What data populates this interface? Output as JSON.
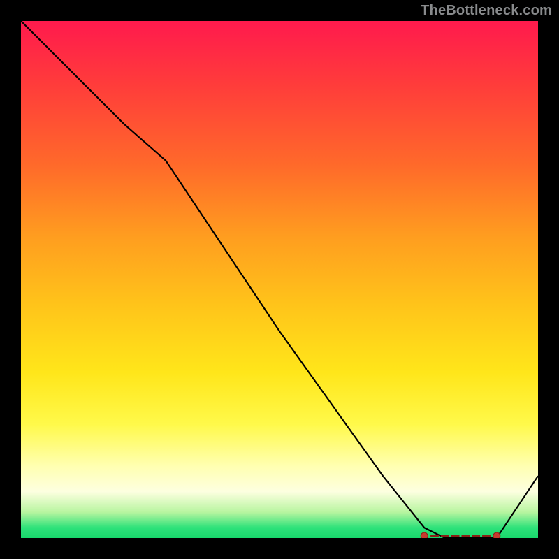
{
  "attribution": "TheBottleneck.com",
  "chart_data": {
    "type": "line",
    "title": "",
    "xlabel": "",
    "ylabel": "",
    "xlim": [
      0,
      100
    ],
    "ylim": [
      0,
      100
    ],
    "x": [
      0,
      10,
      20,
      28,
      40,
      50,
      60,
      70,
      78,
      82,
      86,
      88,
      92,
      100
    ],
    "values": [
      100,
      90,
      80,
      73,
      55,
      40,
      26,
      12,
      2,
      0,
      0,
      0,
      0,
      12
    ],
    "optimal_dot_left_x": 78,
    "optimal_dot_right_x": 92,
    "optimal_dash_x": [
      80,
      82,
      84,
      86,
      88,
      90
    ],
    "optimal_y": 0.4,
    "colors": {
      "curve": "#000000",
      "dot_fill": "#c63b2f",
      "dot_stroke": "#8a1f16",
      "gradient_top": "#ff1a4d",
      "gradient_bottom": "#18d86c"
    }
  }
}
